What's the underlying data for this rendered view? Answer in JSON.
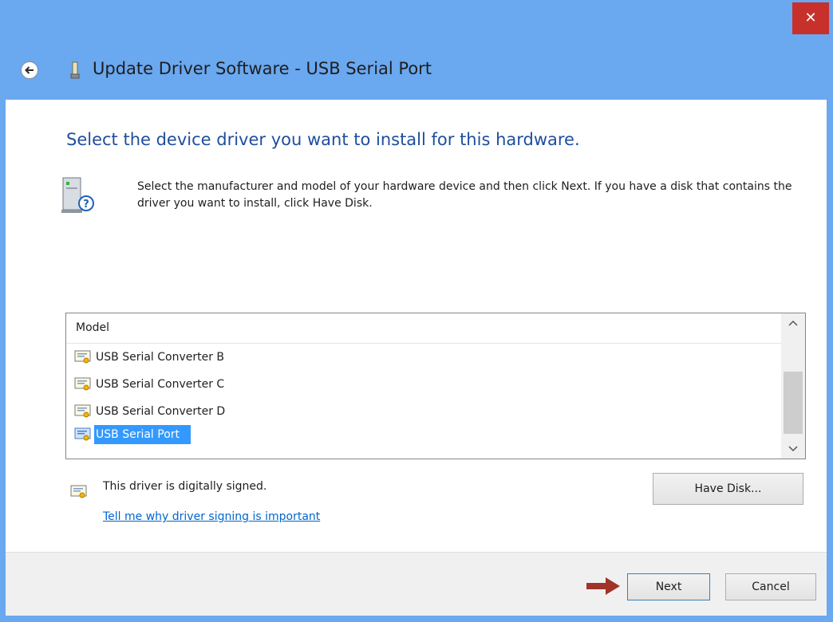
{
  "window": {
    "title": "Update Driver Software - USB Serial Port",
    "close_label": "✕"
  },
  "main": {
    "heading": "Select the device driver you want to install for this hardware.",
    "description": "Select the manufacturer and model of your hardware device and then click Next. If you have a disk that contains the driver you want to install, click Have Disk."
  },
  "model_list": {
    "header": "Model",
    "items": [
      {
        "label": "USB Serial Converter B",
        "selected": false
      },
      {
        "label": "USB Serial Converter C",
        "selected": false
      },
      {
        "label": "USB Serial Converter D",
        "selected": false
      },
      {
        "label": "USB Serial Port",
        "selected": true
      }
    ]
  },
  "signing": {
    "status": "This driver is digitally signed.",
    "link": "Tell me why driver signing is important"
  },
  "buttons": {
    "have_disk": "Have Disk...",
    "next": "Next",
    "cancel": "Cancel"
  },
  "colors": {
    "titlebar": "#6aa8f0",
    "heading": "#1f4e9c",
    "selection": "#3399ff",
    "close": "#c7302b",
    "arrow": "#a0342a"
  }
}
